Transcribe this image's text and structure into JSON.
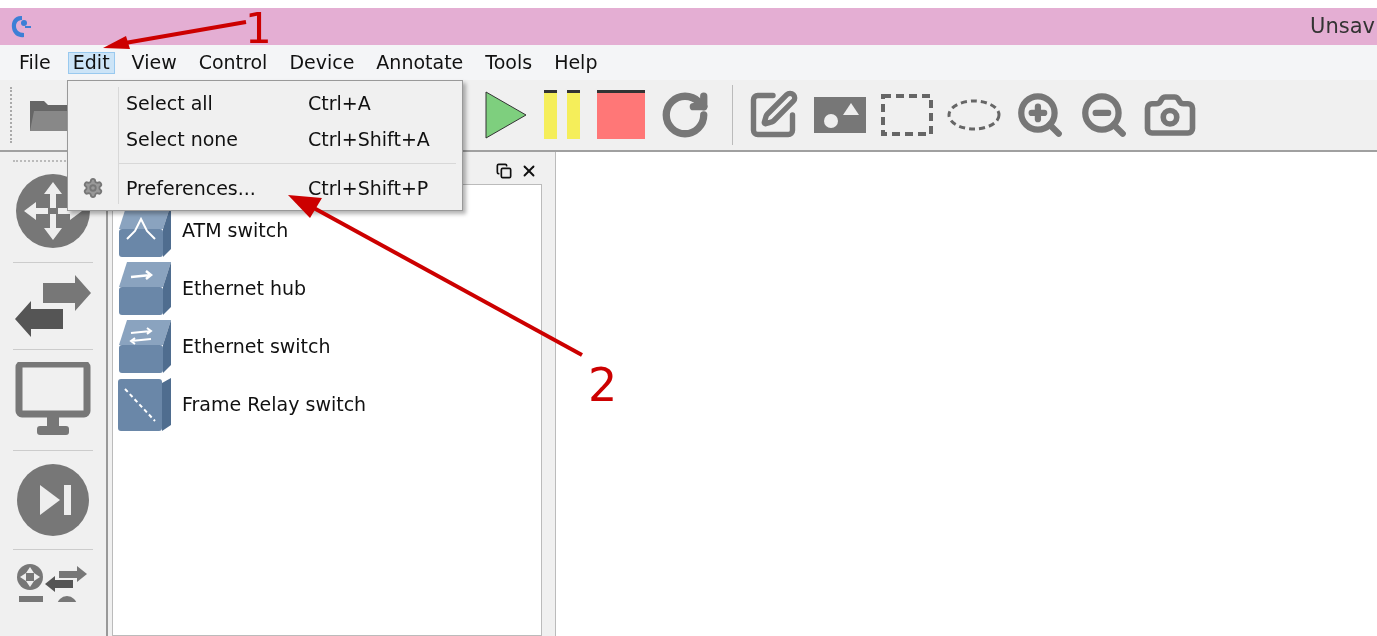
{
  "title_bar": {
    "title": "Unsav"
  },
  "menu_bar": [
    {
      "label": "File",
      "selected": false
    },
    {
      "label": "Edit",
      "selected": true
    },
    {
      "label": "View",
      "selected": false
    },
    {
      "label": "Control",
      "selected": false
    },
    {
      "label": "Device",
      "selected": false
    },
    {
      "label": "Annotate",
      "selected": false
    },
    {
      "label": "Tools",
      "selected": false
    },
    {
      "label": "Help",
      "selected": false
    }
  ],
  "edit_menu": [
    {
      "kind": "action",
      "label": "Select all",
      "shortcut": "Ctrl+A"
    },
    {
      "kind": "action",
      "label": "Select none",
      "shortcut": "Ctrl+Shift+A"
    },
    {
      "kind": "separator"
    },
    {
      "kind": "settings",
      "label": "Preferences...",
      "shortcut": "Ctrl+Shift+P"
    }
  ],
  "devices": [
    {
      "kind": "atm",
      "label": "ATM switch"
    },
    {
      "kind": "hub",
      "label": "Ethernet hub"
    },
    {
      "kind": "switch",
      "label": "Ethernet switch"
    },
    {
      "kind": "frame-relay",
      "label": "Frame Relay switch"
    }
  ],
  "annotations": [
    {
      "label": "1"
    },
    {
      "label": "2"
    }
  ]
}
